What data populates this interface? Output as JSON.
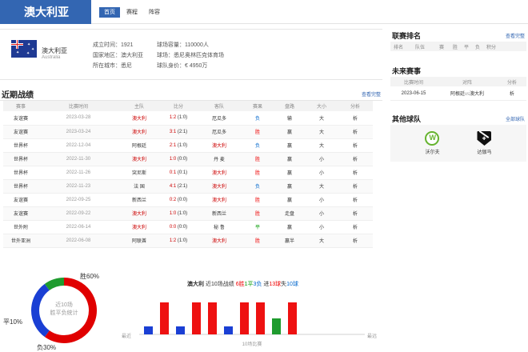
{
  "team": {
    "name": "澳大利亚",
    "name_en": "Australia"
  },
  "tabs": [
    "首页",
    "赛程",
    "阵容"
  ],
  "info": {
    "founded_label": "成立时间：",
    "founded": "1921",
    "capacity_label": "球场容量：",
    "capacity": "110000人",
    "country_label": "国家地区：",
    "country": "澳大利亚",
    "stadium_label": "球场：",
    "stadium": "悉尼奥林匹克体育场",
    "city_label": "所在城市：",
    "city": "悉尼",
    "value_label": "球队身价：",
    "value": "€ 4950万"
  },
  "recent": {
    "title": "近期战绩",
    "more": "查看完整",
    "headers": [
      "赛事",
      "比赛时间",
      "主队",
      "比分",
      "客队",
      "赛果",
      "盘路",
      "大小",
      "分析"
    ],
    "rows": [
      {
        "comp": "友谊赛",
        "date": "2023-03-28",
        "home": "澳大利",
        "score": "1:2",
        "half": "(1:0)",
        "away": "厄瓜多",
        "result": "负",
        "pan": "输",
        "ou": "大",
        "an": "析"
      },
      {
        "comp": "友谊赛",
        "date": "2023-03-24",
        "home": "澳大利",
        "score": "3:1",
        "half": "(2:1)",
        "away": "厄瓜多",
        "result": "胜",
        "pan": "赢",
        "ou": "大",
        "an": "析"
      },
      {
        "comp": "世界杯",
        "date": "2022-12-04",
        "home": "阿根廷",
        "score": "2:1",
        "half": "(1:0)",
        "away": "澳大利",
        "result": "负",
        "pan": "赢",
        "ou": "大",
        "an": "析"
      },
      {
        "comp": "世界杯",
        "date": "2022-11-30",
        "home": "澳大利",
        "score": "1:0",
        "half": "(0:0)",
        "away": "丹 麦",
        "result": "胜",
        "pan": "赢",
        "ou": "小",
        "an": "析"
      },
      {
        "comp": "世界杯",
        "date": "2022-11-26",
        "home": "突尼斯",
        "score": "0:1",
        "half": "(0:1)",
        "away": "澳大利",
        "result": "胜",
        "pan": "赢",
        "ou": "小",
        "an": "析"
      },
      {
        "comp": "世界杯",
        "date": "2022-11-23",
        "home": "法 国",
        "score": "4:1",
        "half": "(2:1)",
        "away": "澳大利",
        "result": "负",
        "pan": "赢",
        "ou": "大",
        "an": "析"
      },
      {
        "comp": "友谊赛",
        "date": "2022-09-25",
        "home": "新西兰",
        "score": "0:2",
        "half": "(0:0)",
        "away": "澳大利",
        "result": "胜",
        "pan": "赢",
        "ou": "小",
        "an": "析"
      },
      {
        "comp": "友谊赛",
        "date": "2022-09-22",
        "home": "澳大利",
        "score": "1:0",
        "half": "(1:0)",
        "away": "新西兰",
        "result": "胜",
        "pan": "走盘",
        "ou": "小",
        "an": "析"
      },
      {
        "comp": "世外附",
        "date": "2022-06-14",
        "home": "澳大利",
        "score": "0:0",
        "half": "(0:0)",
        "away": "秘 鲁",
        "result": "平",
        "pan": "赢",
        "ou": "小",
        "an": "析"
      },
      {
        "comp": "世外亚洲",
        "date": "2022-06-08",
        "home": "阿联酋",
        "score": "1:2",
        "half": "(1:0)",
        "away": "澳大利",
        "result": "胜",
        "pan": "赢半",
        "ou": "大",
        "an": "析"
      }
    ]
  },
  "ranking": {
    "title": "联赛排名",
    "more": "查看完整",
    "headers": [
      "排名",
      "队伍",
      "赛",
      "胜",
      "平",
      "负",
      "积分"
    ]
  },
  "upcoming": {
    "title": "未来赛事",
    "headers": [
      "比赛时间",
      "对阵",
      "分析"
    ],
    "rows": [
      {
        "date": "2023-06-15",
        "home": "阿根廷",
        "vs": "vs",
        "away": "澳大利",
        "an": "析"
      }
    ]
  },
  "clubs": {
    "title": "其他球队",
    "more": "全部球队",
    "items": [
      {
        "name": "沃尔夫",
        "logo": "wolfsburg-logo"
      },
      {
        "name": "达伽马",
        "logo": "vasco-logo"
      }
    ]
  },
  "donut": {
    "center1": "近10场",
    "center2": "胜平负统计",
    "win_label": "胜60%",
    "draw_label": "平10%",
    "lose_label": "负30%",
    "win": 60,
    "draw": 10,
    "lose": 30,
    "colors": {
      "win": "#e00000",
      "draw": "#1e9b2e",
      "lose": "#1a3fd4"
    }
  },
  "summary": {
    "team": "澳大利",
    "pre": " 近10场战绩 ",
    "win": "6胜",
    "draw": "1平",
    "lose": "3负",
    "goals_pre": " 进",
    "goals_for": "13球",
    "goals_mid": "失",
    "goals_against": "10球"
  },
  "chart_data": {
    "type": "bar",
    "xlabel": "10场比赛",
    "left_label": "最近",
    "right_label": "最远",
    "categories": [
      "1",
      "2",
      "3",
      "4",
      "5",
      "6",
      "7",
      "8",
      "9",
      "10"
    ],
    "results": [
      "负",
      "胜",
      "负",
      "胜",
      "胜",
      "负",
      "胜",
      "胜",
      "平",
      "胜"
    ],
    "values": [
      1,
      4,
      1,
      4,
      4,
      1,
      4,
      4,
      2,
      4
    ],
    "colors": {
      "胜": "#ee1111",
      "负": "#1a3fd4",
      "平": "#1e9b2e"
    }
  }
}
